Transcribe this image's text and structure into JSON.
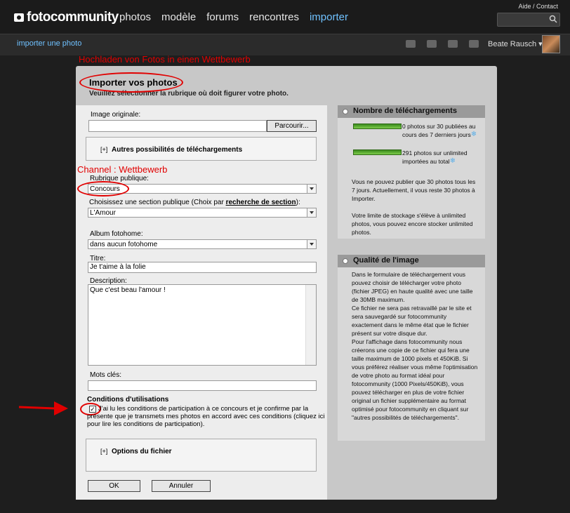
{
  "header": {
    "logo": "fotocommunity",
    "nav": [
      "photos",
      "modèle",
      "forums",
      "rencontres",
      "importer"
    ],
    "active_nav": "importer",
    "help": "Aide / Contact"
  },
  "subbar": {
    "breadcrumb": "importer une photo",
    "user": "Beate Rausch"
  },
  "annotations": {
    "top": "Hochladen von Fotos in einen Wettbewerb",
    "channel": "Channel : Wettbewerb"
  },
  "panel": {
    "title": "Importer vos photos",
    "subtitle": "Veuillez sélectionner la rubrique où doit figurer votre photo."
  },
  "form": {
    "image_label": "Image originale:",
    "browse": "Parcourir...",
    "more_upload_plus": "[+]",
    "more_upload": "Autres possibilités de téléchargements",
    "rubrique_label": "Rubrique publique:",
    "rubrique_value": "Concours",
    "section_label_pre": "Choisissez une section publique (Choix par",
    "section_label_link": "recherche de section",
    "section_label_post": "):",
    "section_value": "L'Amour",
    "album_label": "Album fotohome:",
    "album_value": "dans aucun fotohome",
    "titre_label": "Titre:",
    "titre_value": "Je t'aime à la folie",
    "desc_label": "Description:",
    "desc_value": "Que c'est beau l'amour !",
    "keywords_label": "Mots clés:",
    "keywords_value": "",
    "conditions_title": "Conditions d'utilisations",
    "conditions_text": "J'ai lu les conditions de participation à ce concours et je confirme par la présente que je transmets mes photos en accord avec ces conditions (cliquez ici pour lire les conditions de participation).",
    "options_plus": "[+]",
    "options": "Options du fichier",
    "ok": "OK",
    "cancel": "Annuler"
  },
  "sidebar": {
    "downloads_title": "Nombre de téléchargements",
    "stat1": "0 photos sur 30 publiées au cours des 7 derniers jours",
    "stat2": "291 photos sur unlimited importées au total",
    "info1": "Vous ne pouvez publier que 30 photos tous les 7 jours. Actuellement, il vous reste 30 photos à Importer.",
    "info2": "Votre limite de stockage s'élève à unlimited photos, vous pouvez encore stocker unlimited photos.",
    "quality_title": "Qualité de l'image",
    "quality_text": "Dans le formulaire de téléchargement vous pouvez choisir de télécharger votre photo (fichier JPEG) en haute qualité avec une taille de 30MB maximum.\nCe fichier ne sera pas retravaillé par le site et sera sauvegardé sur fotocommunity exactement dans le même état que le fichier présent sur votre disque dur.\nPour l'affichage dans fotocommunity nous créerons une copie de ce fichier qui fera une taille maximum de 1000 pixels et 450KiB. Si vous préférez réaliser vous même l'optimisation de votre photo au format idéal pour fotocommunity (1000 Pixels/450KiB), vous pouvez télécharger en plus de votre fichier original un fichier supplémentaire au format optimisé pour fotocommunity en cliquant sur \"autres possibilités de téléchargements\"."
  },
  "colors": {
    "accent": "#6fc1ff",
    "annotation": "#e10000",
    "bar": "#5bb33a"
  }
}
